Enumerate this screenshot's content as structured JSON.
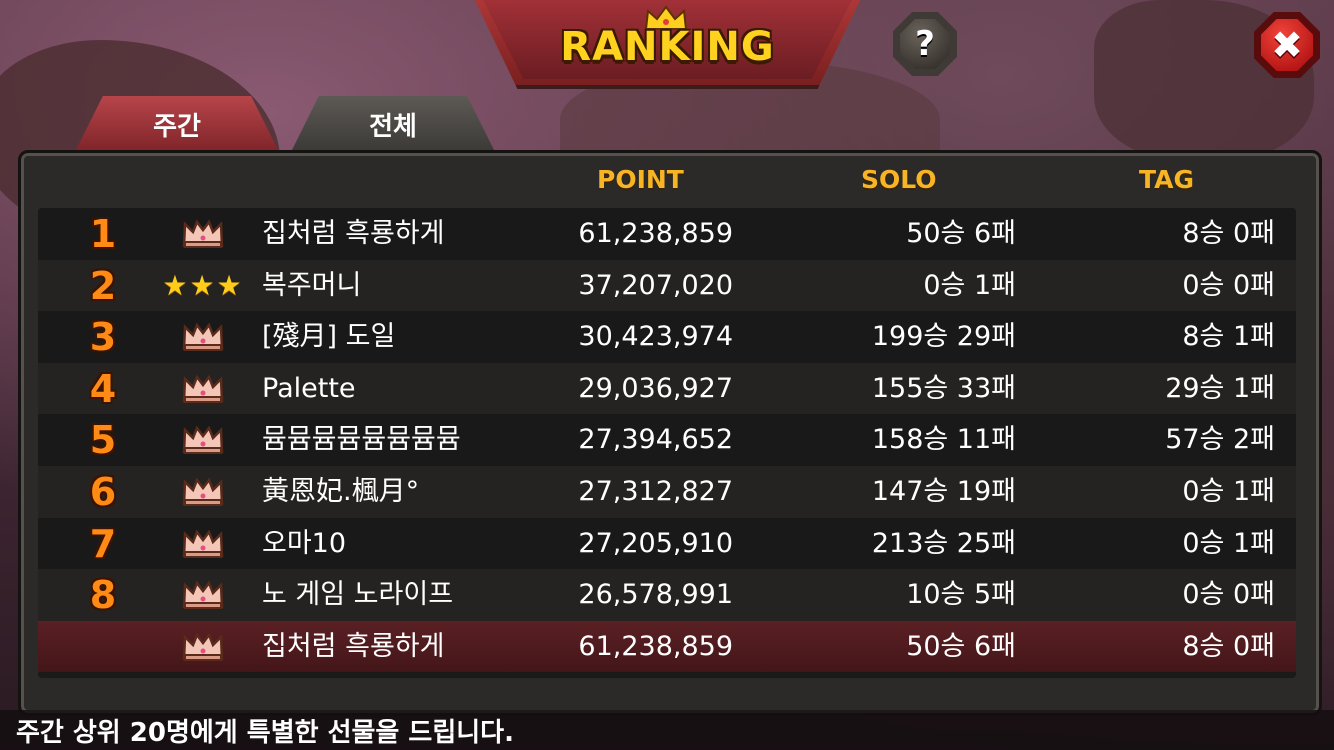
{
  "header": {
    "title": "RANKING",
    "help_label": "?",
    "close_label": "✖"
  },
  "tabs": [
    {
      "label": "주간",
      "active": true
    },
    {
      "label": "전체",
      "active": false
    }
  ],
  "columns": {
    "point": "POINT",
    "solo": "SOLO",
    "tag": "TAG"
  },
  "rows": [
    {
      "rank": "1",
      "badge": "crown-icon",
      "name": "집처럼 흑룡하게",
      "point": "61,238,859",
      "solo": "50승 6패",
      "tag": "8승 0패"
    },
    {
      "rank": "2",
      "badge": "stars",
      "stars": "★★★",
      "name": "복주머니",
      "point": "37,207,020",
      "solo": "0승 1패",
      "tag": "0승 0패"
    },
    {
      "rank": "3",
      "badge": "crown-icon",
      "name": "[殘月] 도일",
      "point": "30,423,974",
      "solo": "199승 29패",
      "tag": "8승 1패"
    },
    {
      "rank": "4",
      "badge": "crown-icon",
      "name": "Palette",
      "point": "29,036,927",
      "solo": "155승 33패",
      "tag": "29승 1패"
    },
    {
      "rank": "5",
      "badge": "crown-icon",
      "name": "뮴뮴뮴뮴뮴뮴뮴뮴",
      "point": "27,394,652",
      "solo": "158승 11패",
      "tag": "57승 2패"
    },
    {
      "rank": "6",
      "badge": "crown-icon",
      "name": "黃恩妃.楓月°",
      "point": "27,312,827",
      "solo": "147승 19패",
      "tag": "0승 1패"
    },
    {
      "rank": "7",
      "badge": "crown-icon",
      "name": "오마10",
      "point": "27,205,910",
      "solo": "213승 25패",
      "tag": "0승 1패"
    },
    {
      "rank": "8",
      "badge": "crown-icon",
      "name": "노 게임 노라이프",
      "point": "26,578,991",
      "solo": "10승 5패",
      "tag": "0승 0패"
    }
  ],
  "my_row": {
    "rank": "",
    "badge": "crown-icon",
    "name": "집처럼 흑룡하게",
    "point": "61,238,859",
    "solo": "50승 6패",
    "tag": "8승 0패"
  },
  "footer": {
    "notice": "주간 상위 20명에게 특별한 선물을 드립니다."
  },
  "colors": {
    "title": "#ffd21f",
    "column_header": "#f7b526",
    "rank_number": "#ff8a16",
    "active_tab": "#b7454a",
    "my_row": "#5a2024"
  }
}
